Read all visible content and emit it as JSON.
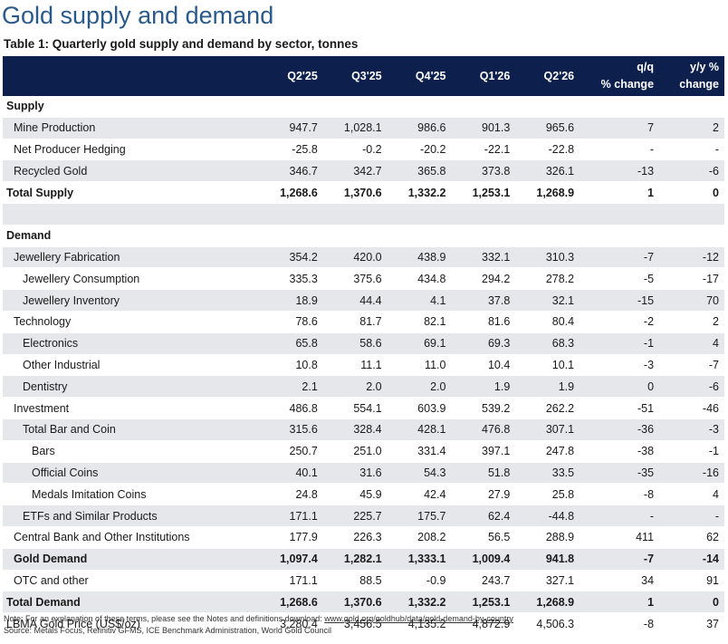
{
  "title": "Gold supply and demand",
  "subtitle": "Table 1: Quarterly gold supply and demand by sector, tonnes",
  "header": {
    "label": "",
    "q2_25": "Q2'25",
    "q3_25": "Q3'25",
    "q4_25": "Q4'25",
    "q1_26": "Q1'26",
    "q2_26": "Q2'26",
    "qq_line1": "q/q",
    "qq_line2": "% change",
    "yy_line1": "y/y %",
    "yy_line2": "change"
  },
  "rows": [
    {
      "label": "Supply",
      "cells": [
        "",
        "",
        "",
        "",
        "",
        "",
        ""
      ]
    },
    {
      "label": "Mine Production",
      "cells": [
        "947.7",
        "1,028.1",
        "986.6",
        "901.3",
        "965.6",
        "7",
        "2"
      ]
    },
    {
      "label": "Net Producer Hedging",
      "cells": [
        "-25.8",
        "-0.2",
        "-20.2",
        "-22.1",
        "-22.8",
        "-",
        "-"
      ]
    },
    {
      "label": "Recycled Gold",
      "cells": [
        "346.7",
        "342.7",
        "365.8",
        "373.8",
        "326.1",
        "-13",
        "-6"
      ]
    },
    {
      "label": "Total Supply",
      "cells": [
        "1,268.6",
        "1,370.6",
        "1,332.2",
        "1,253.1",
        "1,268.9",
        "1",
        "0"
      ]
    },
    {
      "label": "",
      "cells": [
        "",
        "",
        "",
        "",
        "",
        "",
        ""
      ]
    },
    {
      "label": "Demand",
      "cells": [
        "",
        "",
        "",
        "",
        "",
        "",
        ""
      ]
    },
    {
      "label": "Jewellery Fabrication",
      "cells": [
        "354.2",
        "420.0",
        "438.9",
        "332.1",
        "310.3",
        "-7",
        "-12"
      ]
    },
    {
      "label": "Jewellery Consumption",
      "cells": [
        "335.3",
        "375.6",
        "434.8",
        "294.2",
        "278.2",
        "-5",
        "-17"
      ]
    },
    {
      "label": "Jewellery Inventory",
      "cells": [
        "18.9",
        "44.4",
        "4.1",
        "37.8",
        "32.1",
        "-15",
        "70"
      ]
    },
    {
      "label": "Technology",
      "cells": [
        "78.6",
        "81.7",
        "82.1",
        "81.6",
        "80.4",
        "-2",
        "2"
      ]
    },
    {
      "label": "Electronics",
      "cells": [
        "65.8",
        "58.6",
        "69.1",
        "69.3",
        "68.3",
        "-1",
        "4"
      ]
    },
    {
      "label": "Other Industrial",
      "cells": [
        "10.8",
        "11.1",
        "11.0",
        "10.4",
        "10.1",
        "-3",
        "-7"
      ]
    },
    {
      "label": "Dentistry",
      "cells": [
        "2.1",
        "2.0",
        "2.0",
        "1.9",
        "1.9",
        "0",
        "-6"
      ]
    },
    {
      "label": "Investment",
      "cells": [
        "486.8",
        "554.1",
        "603.9",
        "539.2",
        "262.2",
        "-51",
        "-46"
      ]
    },
    {
      "label": "Total Bar and Coin",
      "cells": [
        "315.6",
        "328.4",
        "428.1",
        "476.8",
        "307.1",
        "-36",
        "-3"
      ]
    },
    {
      "label": "Bars",
      "cells": [
        "250.7",
        "251.0",
        "331.4",
        "397.1",
        "247.8",
        "-38",
        "-1"
      ]
    },
    {
      "label": "Official Coins",
      "cells": [
        "40.1",
        "31.6",
        "54.3",
        "51.8",
        "33.5",
        "-35",
        "-16"
      ]
    },
    {
      "label": "Medals Imitation Coins",
      "cells": [
        "24.8",
        "45.9",
        "42.4",
        "27.9",
        "25.8",
        "-8",
        "4"
      ]
    },
    {
      "label": "ETFs and Similar Products",
      "cells": [
        "171.1",
        "225.7",
        "175.7",
        "62.4",
        "-44.8",
        "-",
        "-"
      ]
    },
    {
      "label": "Central Bank and Other Institutions",
      "cells": [
        "177.9",
        "226.3",
        "208.2",
        "56.5",
        "288.9",
        "411",
        "62"
      ]
    },
    {
      "label": "Gold Demand",
      "cells": [
        "1,097.4",
        "1,282.1",
        "1,333.1",
        "1,009.4",
        "941.8",
        "-7",
        "-14"
      ]
    },
    {
      "label": "OTC and other",
      "cells": [
        "171.1",
        "88.5",
        "-0.9",
        "243.7",
        "327.1",
        "34",
        "91"
      ]
    },
    {
      "label": "Total Demand",
      "cells": [
        "1,268.6",
        "1,370.6",
        "1,332.2",
        "1,253.1",
        "1,268.9",
        "1",
        "0"
      ]
    },
    {
      "label": "LBMA Gold Price (US$/oz)",
      "cells": [
        "3,280.4",
        "3,456.5",
        "4,135.2",
        "4,872.9",
        "4,506.3",
        "-8",
        "37"
      ]
    }
  ],
  "notes": {
    "note_prefix": "Note: For an explanation of these terms, please see the Notes and definitions download: ",
    "note_link": "www.gold.org/goldhub/data/gold-demand-by-country",
    "source": "Source: Metals Focus, Refinitiv GFMS, ICE Benchmark Administration, World Gold Council"
  }
}
